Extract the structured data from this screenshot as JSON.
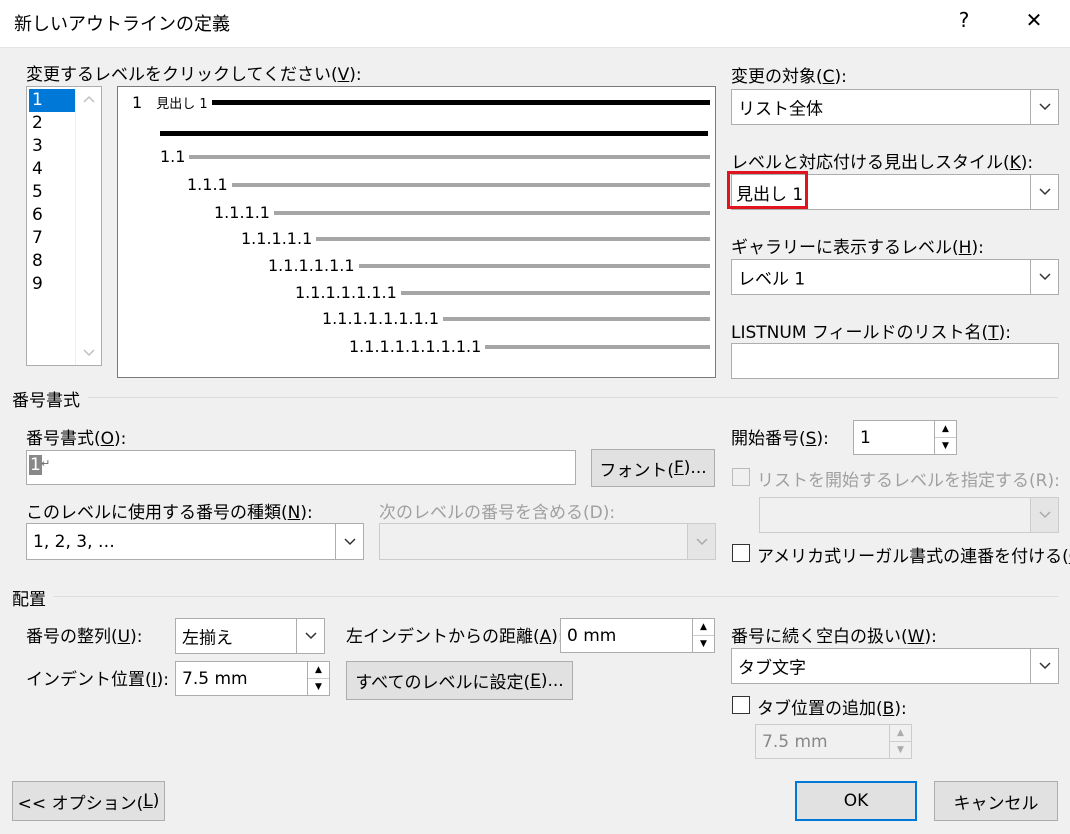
{
  "window": {
    "title": "新しいアウトラインの定義",
    "help": "?",
    "close": "✕"
  },
  "levels": {
    "label_pre": "変更するレベルをクリックしてください(",
    "label_key": "V",
    "label_post": "):",
    "items": [
      "1",
      "2",
      "3",
      "4",
      "5",
      "6",
      "7",
      "8",
      "9"
    ],
    "selected": "1"
  },
  "preview": {
    "first_num": "1",
    "first_text": "見出し 1",
    "rows": [
      "1.1",
      "1.1.1",
      "1.1.1.1",
      "1.1.1.1.1",
      "1.1.1.1.1.1",
      "1.1.1.1.1.1.1",
      "1.1.1.1.1.1.1.1",
      "1.1.1.1.1.1.1.1.1"
    ]
  },
  "apply_to": {
    "label_pre": "変更の対象(",
    "label_key": "C",
    "label_post": "):",
    "value": "リスト全体"
  },
  "heading_style": {
    "label_pre": "レベルと対応付ける見出しスタイル(",
    "label_key": "K",
    "label_post": "):",
    "value": "見出し 1",
    "highlight_color": "#e0141e"
  },
  "gallery_level": {
    "label_pre": "ギャラリーに表示するレベル(",
    "label_key": "H",
    "label_post": "):",
    "value": "レベル 1"
  },
  "listnum": {
    "label_pre": "LISTNUM フィールドのリスト名(",
    "label_key": "T",
    "label_post": "):",
    "value": ""
  },
  "number_format_section": {
    "title": "番号書式"
  },
  "number_format": {
    "label_pre": "番号書式(",
    "label_key": "O",
    "label_post": "):",
    "value": "1",
    "mark": "↵"
  },
  "font_button": {
    "label_pre": "フォント(",
    "label_key": "F",
    "label_post": ")..."
  },
  "number_style": {
    "label_pre": "このレベルに使用する番号の種類(",
    "label_key": "N",
    "label_post": "):",
    "value": "1, 2, 3, …"
  },
  "include_level": {
    "label": "次のレベルの番号を含める(D):",
    "value": ""
  },
  "start_at": {
    "label_pre": "開始番号(",
    "label_key": "S",
    "label_post": "):",
    "value": "1"
  },
  "restart_list": {
    "label": "リストを開始するレベルを指定する(R):",
    "value": ""
  },
  "legal_style": {
    "label_pre": "アメリカ式リーガル書式の連番を付ける(",
    "label_key": "G",
    "label_post": ")"
  },
  "position_section": {
    "title": "配置"
  },
  "alignment": {
    "label_pre": "番号の整列(",
    "label_key": "U",
    "label_post": "):",
    "value": "左揃え"
  },
  "aligned_at": {
    "label_pre": "左インデントからの距離(",
    "label_key": "A",
    "label_post": "):",
    "value": "0 mm"
  },
  "indent_at": {
    "label_pre": "インデント位置(",
    "label_key": "I",
    "label_post": "):",
    "value": "7.5 mm"
  },
  "set_all_button": {
    "label_pre": "すべてのレベルに設定(",
    "label_key": "E",
    "label_post": ")..."
  },
  "follow_with": {
    "label_pre": "番号に続く空白の扱い(",
    "label_key": "W",
    "label_post": "):",
    "value": "タブ文字"
  },
  "add_tab": {
    "label_pre": "タブ位置の追加(",
    "label_key": "B",
    "label_post": "):",
    "value": "7.5 mm"
  },
  "options_button": {
    "label_pre": "<< オプション(",
    "label_key": "L",
    "label_post": ")"
  },
  "ok_button": {
    "label": "OK"
  },
  "cancel_button": {
    "label": "キャンセル"
  }
}
